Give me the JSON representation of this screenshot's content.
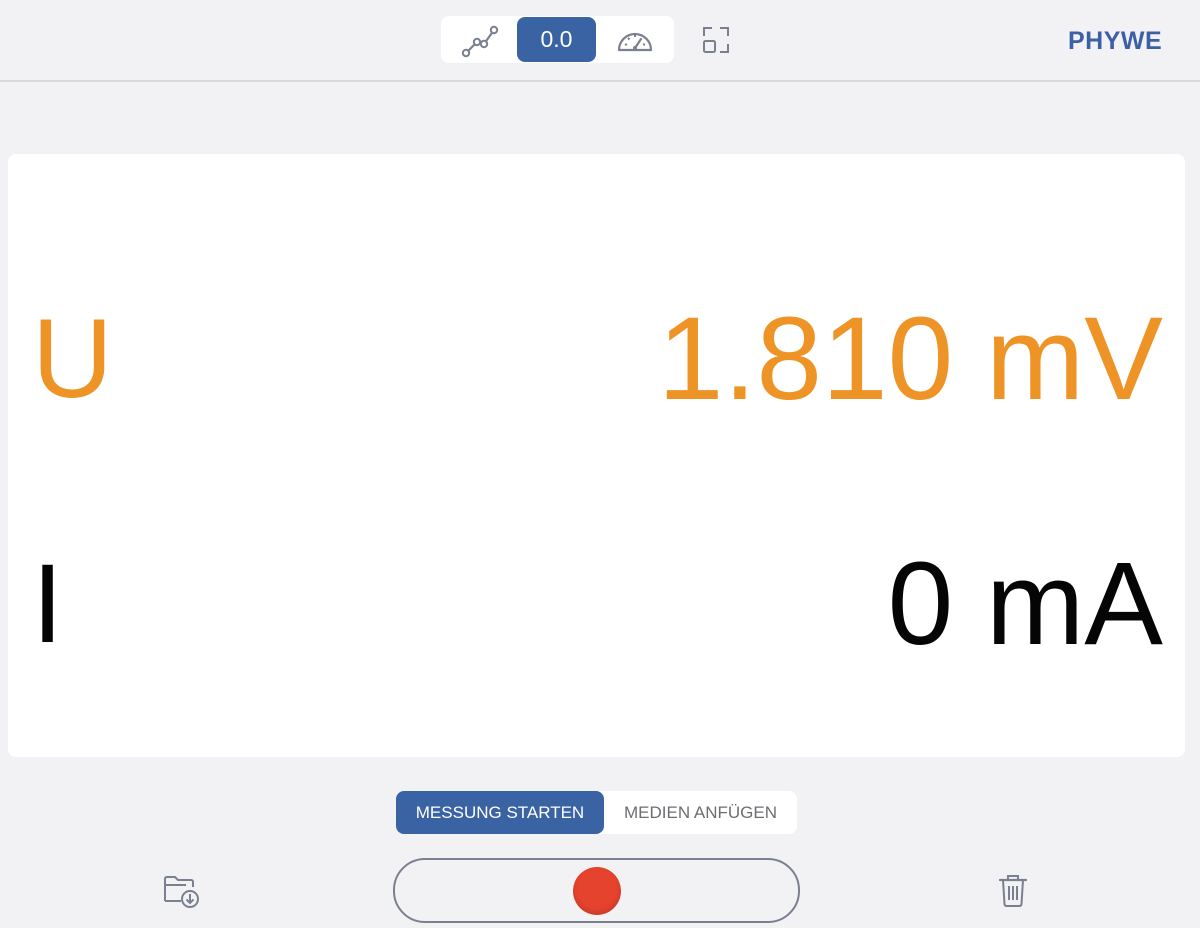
{
  "toolbar": {
    "views": [
      {
        "name": "graph",
        "icon": "line-graph-icon"
      },
      {
        "name": "digital",
        "label": "0.0"
      },
      {
        "name": "gauge",
        "icon": "gauge-icon"
      }
    ],
    "fullscreen_icon": "fullscreen-icon",
    "logo": "PHYWE"
  },
  "readings": [
    {
      "symbol": "U",
      "value": "1.810 mV",
      "color": "#ee9427"
    },
    {
      "symbol": "I",
      "value": "0 mA",
      "color": "#050505"
    }
  ],
  "modes": {
    "start_label": "MESSUNG STARTEN",
    "media_label": "MEDIEN ANFÜGEN"
  },
  "controls": {
    "save_icon": "folder-download-icon",
    "record_icon": "record-icon",
    "trash_icon": "trash-icon"
  },
  "colors": {
    "accent": "#3a63a3",
    "record": "#e5432e"
  }
}
